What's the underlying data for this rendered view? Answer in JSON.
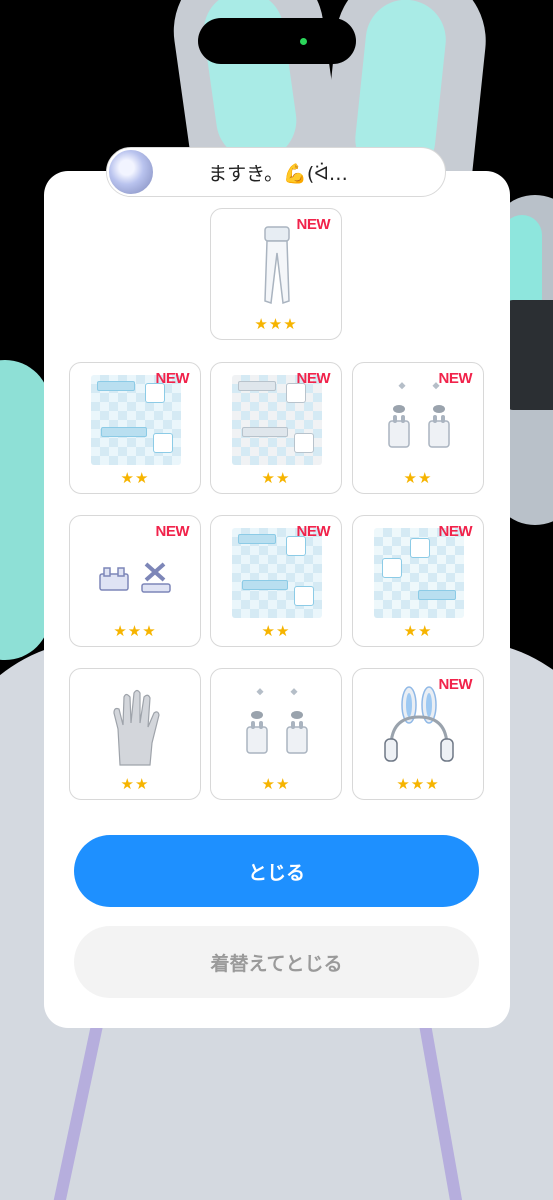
{
  "header": {
    "user_name": "ますき。💪(ᐛ…"
  },
  "items": [
    {
      "kind": "tights",
      "new_label": "NEW",
      "stars": "★★★"
    },
    {
      "kind": "pattern-blue",
      "new_label": "NEW",
      "stars": "★★"
    },
    {
      "kind": "pattern-gray",
      "new_label": "NEW",
      "stars": "★★"
    },
    {
      "kind": "bunny-earrings",
      "new_label": "NEW",
      "stars": "★★"
    },
    {
      "kind": "hair-clips",
      "new_label": "NEW",
      "stars": "★★★"
    },
    {
      "kind": "pattern-blue",
      "new_label": "NEW",
      "stars": "★★"
    },
    {
      "kind": "pattern-light",
      "new_label": "NEW",
      "stars": "★★"
    },
    {
      "kind": "glove",
      "new_label": "",
      "stars": "★★"
    },
    {
      "kind": "bunny-earrings",
      "new_label": "",
      "stars": "★★"
    },
    {
      "kind": "bunny-headphones",
      "new_label": "NEW",
      "stars": "★★★"
    }
  ],
  "buttons": {
    "close_label": "とじる",
    "change_and_close_label": "着替えてとじる"
  },
  "colors": {
    "primary": "#1e90ff",
    "new_badge": "#f1234b",
    "star": "#f6b400",
    "secondary_button": "#f3f3f3"
  }
}
